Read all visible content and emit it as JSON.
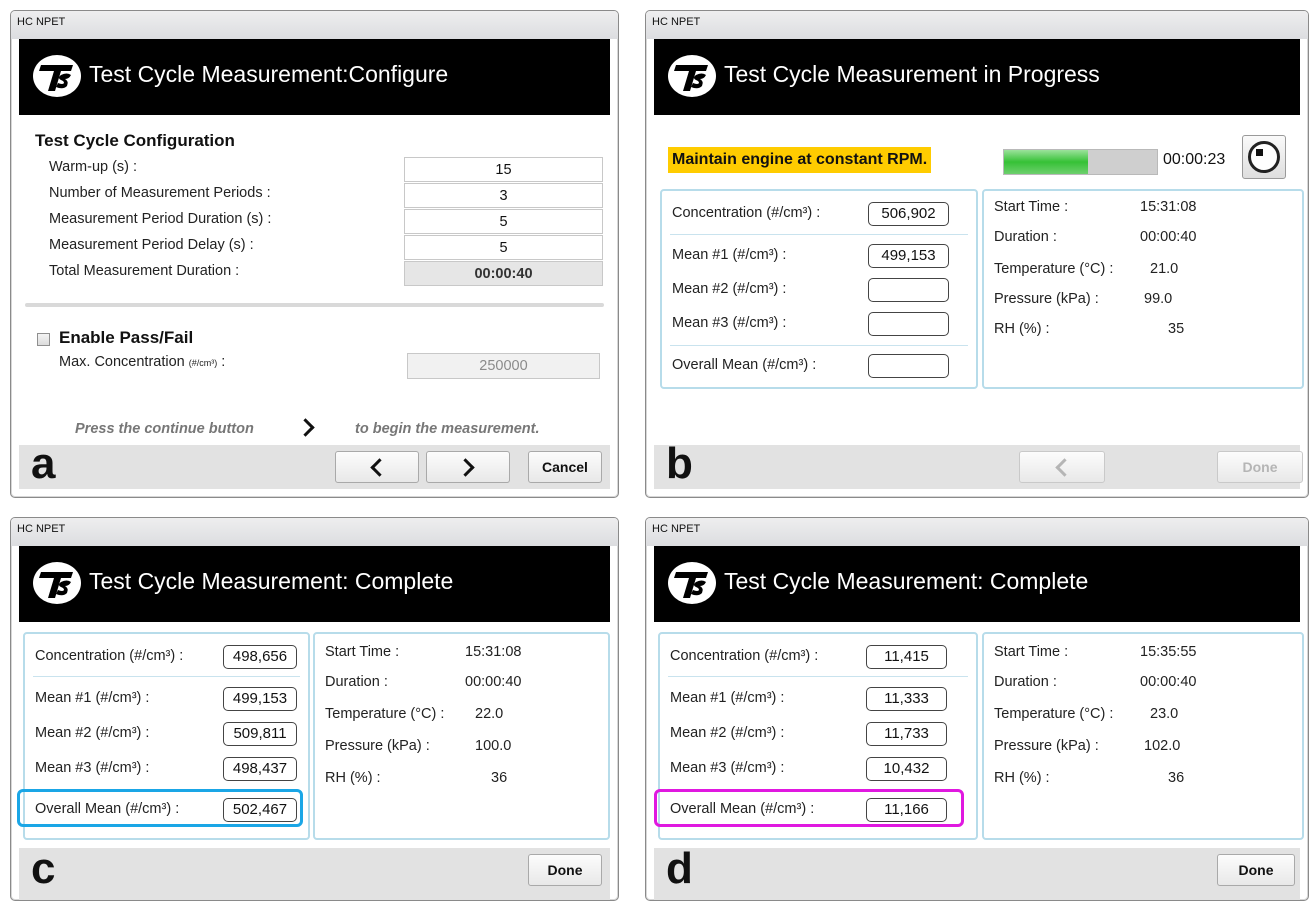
{
  "window_title": "HC NPET",
  "panels": {
    "a": {
      "letter": "a",
      "title": "Test Cycle Measurement:Configure",
      "section_heading": "Test Cycle Configuration",
      "fields": [
        {
          "label": "Warm-up (s)",
          "value": "15"
        },
        {
          "label": "Number of Measurement Periods",
          "value": "3"
        },
        {
          "label": "Measurement Period Duration (s)",
          "value": "5"
        },
        {
          "label": "Measurement Period Delay (s)",
          "value": "5"
        },
        {
          "label": "Total Measurement Duration",
          "value": "00:00:40"
        }
      ],
      "enable_pass_fail_label": "Enable Pass/Fail",
      "enable_pass_fail_checked": false,
      "max_concentration_label": "Max. Concentration",
      "max_concentration_unit": "(#/cm³)",
      "max_concentration_value": "250000",
      "instruction_before": "Press the continue button",
      "instruction_after": "to begin the measurement.",
      "cancel_label": "Cancel"
    },
    "b": {
      "letter": "b",
      "title": "Test Cycle Measurement in Progress",
      "banner": "Maintain engine at constant RPM.",
      "progress_percent": 55,
      "elapsed": "00:00:23",
      "measurements": [
        {
          "label": "Concentration  (#/cm³) :",
          "value": "506,902"
        },
        {
          "label": "Mean #1  (#/cm³) :",
          "value": "499,153"
        },
        {
          "label": "Mean #2  (#/cm³) :",
          "value": ""
        },
        {
          "label": "Mean #3  (#/cm³) :",
          "value": ""
        },
        {
          "label": "Overall Mean  (#/cm³) :",
          "value": ""
        }
      ],
      "info": [
        {
          "label": "Start Time :",
          "value": "15:31:08"
        },
        {
          "label": "Duration :",
          "value": "00:00:40"
        },
        {
          "label": "Temperature (°C) :",
          "value": "21.0"
        },
        {
          "label": "Pressure (kPa) :",
          "value": "99.0"
        },
        {
          "label": "RH (%) :",
          "value": "35"
        }
      ],
      "done_label": "Done"
    },
    "c": {
      "letter": "c",
      "title": "Test Cycle Measurement: Complete",
      "measurements": [
        {
          "label": "Concentration  (#/cm³) :",
          "value": "498,656"
        },
        {
          "label": "Mean #1  (#/cm³) :",
          "value": "499,153"
        },
        {
          "label": "Mean #2  (#/cm³) :",
          "value": "509,811"
        },
        {
          "label": "Mean #3  (#/cm³) :",
          "value": "498,437"
        },
        {
          "label": "Overall Mean  (#/cm³) :",
          "value": "502,467"
        }
      ],
      "info": [
        {
          "label": "Start Time :",
          "value": "15:31:08"
        },
        {
          "label": "Duration :",
          "value": "00:00:40"
        },
        {
          "label": "Temperature (°C) :",
          "value": "22.0"
        },
        {
          "label": "Pressure (kPa) :",
          "value": "100.0"
        },
        {
          "label": "RH (%) :",
          "value": "36"
        }
      ],
      "highlight_color": "#1aa6e6",
      "done_label": "Done"
    },
    "d": {
      "letter": "d",
      "title": "Test Cycle Measurement: Complete",
      "measurements": [
        {
          "label": "Concentration  (#/cm³) :",
          "value": "11,415"
        },
        {
          "label": "Mean #1  (#/cm³) :",
          "value": "11,333"
        },
        {
          "label": "Mean #2  (#/cm³) :",
          "value": "11,733"
        },
        {
          "label": "Mean #3  (#/cm³) :",
          "value": "10,432"
        },
        {
          "label": "Overall Mean  (#/cm³) :",
          "value": "11,166"
        }
      ],
      "info": [
        {
          "label": "Start Time :",
          "value": "15:35:55"
        },
        {
          "label": "Duration :",
          "value": "00:00:40"
        },
        {
          "label": "Temperature (°C) :",
          "value": "23.0"
        },
        {
          "label": "Pressure (kPa) :",
          "value": "102.0"
        },
        {
          "label": "RH (%) :",
          "value": "36"
        }
      ],
      "highlight_color": "#e018e0",
      "done_label": "Done"
    }
  },
  "colors": {
    "title_bar": "#000000",
    "banner": "#ffcc00",
    "progress": "#36c136",
    "panel_border": "#b7dcea"
  },
  "icons": {
    "logo": "tsi-logo-icon",
    "back": "chevron-left-icon",
    "continue": "chevron-right-icon",
    "stop": "stop-icon"
  }
}
